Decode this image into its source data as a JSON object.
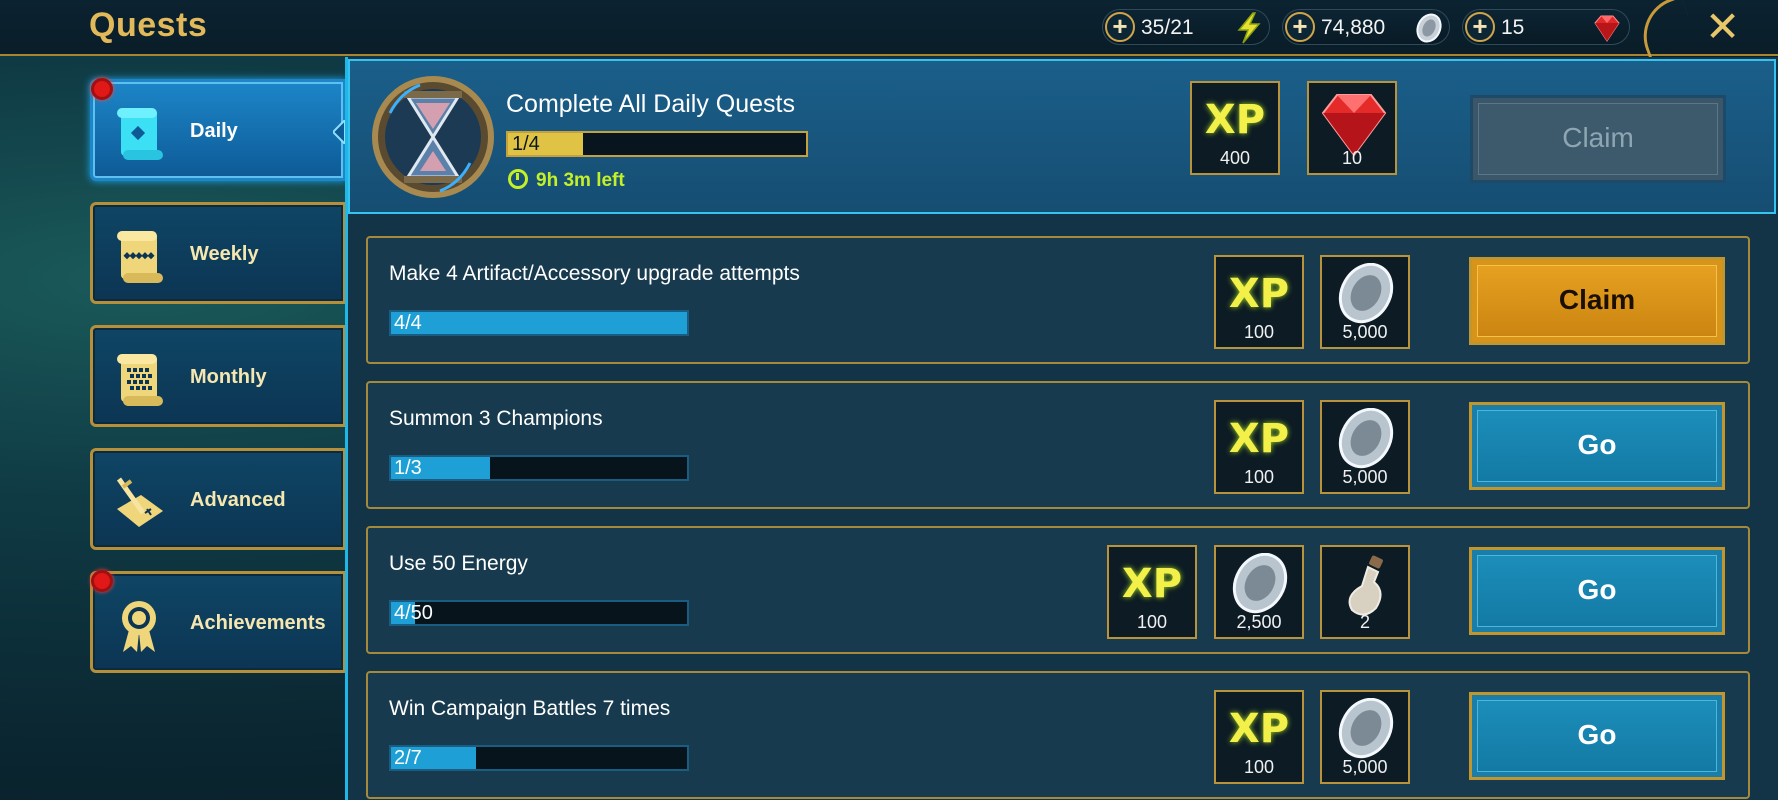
{
  "header": {
    "title": "Quests"
  },
  "resources": [
    {
      "value": "35/21",
      "icon": "energy-bolt-icon"
    },
    {
      "value": "74,880",
      "icon": "silver-coin-icon"
    },
    {
      "value": "15",
      "icon": "gem-icon"
    }
  ],
  "tabs": [
    {
      "label": "Daily",
      "active": true,
      "notification": true
    },
    {
      "label": "Weekly",
      "active": false,
      "notification": false
    },
    {
      "label": "Monthly",
      "active": false,
      "notification": false
    },
    {
      "label": "Advanced",
      "active": false,
      "notification": false
    },
    {
      "label": "Achievements",
      "active": false,
      "notification": true
    }
  ],
  "daily_summary": {
    "title": "Complete All Daily Quests",
    "progress_text": "1/4",
    "progress": 0.25,
    "time_left": "9h 3m left",
    "rewards": [
      {
        "type": "XP",
        "amount": "400"
      },
      {
        "type": "gem",
        "amount": "10"
      }
    ],
    "button": "Claim"
  },
  "quests": [
    {
      "title": "Make 4 Artifact/Accessory upgrade attempts",
      "progress_text": "4/4",
      "progress": 1.0,
      "rewards": [
        {
          "type": "XP",
          "amount": "100"
        },
        {
          "type": "silver",
          "amount": "5,000"
        }
      ],
      "button": "Claim"
    },
    {
      "title": "Summon 3 Champions",
      "progress_text": "1/3",
      "progress": 0.333,
      "rewards": [
        {
          "type": "XP",
          "amount": "100"
        },
        {
          "type": "silver",
          "amount": "5,000"
        }
      ],
      "button": "Go"
    },
    {
      "title": "Use 50 Energy",
      "progress_text": "4/50",
      "progress": 0.08,
      "rewards": [
        {
          "type": "XP",
          "amount": "100"
        },
        {
          "type": "silver",
          "amount": "2,500"
        },
        {
          "type": "potion",
          "amount": "2"
        }
      ],
      "button": "Go"
    },
    {
      "title": "Win Campaign Battles 7 times",
      "progress_text": "2/7",
      "progress": 0.286,
      "rewards": [
        {
          "type": "XP",
          "amount": "100"
        },
        {
          "type": "silver",
          "amount": "5,000"
        }
      ],
      "button": "Go"
    }
  ],
  "reward_xp_label": "XP",
  "colors": {
    "accent_gold": "#c89a3a",
    "go_button": "#1a88b5",
    "claim_button": "#e09a1c",
    "timer": "#c4f027"
  }
}
